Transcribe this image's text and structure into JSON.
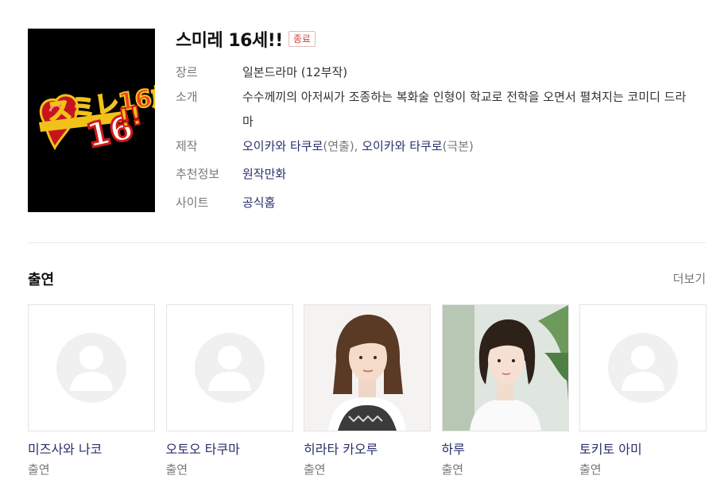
{
  "drama": {
    "title": "스미레 16세!!",
    "status_badge": "종료",
    "poster_logo": "スミレ16歳!!",
    "info": {
      "genre_label": "장르",
      "genre_value": "일본드라마 (12부작)",
      "intro_label": "소개",
      "intro_value": "수수께끼의 아저씨가 조종하는 복화술 인형이 학교로 전학을 오면서 펼쳐지는 코미디 드라마",
      "production_label": "제작",
      "production_director_name": "오이카와 타쿠로",
      "production_director_role": "(연출),",
      "production_writer_name": "오이카와 타쿠로",
      "production_writer_role": "(극본)",
      "recommend_label": "추천정보",
      "recommend_value": "원작만화",
      "site_label": "사이트",
      "site_value": "공식홈"
    }
  },
  "cast_section": {
    "title": "출연",
    "more_label": "더보기",
    "members": [
      {
        "name": "미즈사와 나코",
        "role": "출연",
        "photo": "placeholder-avatar-icon"
      },
      {
        "name": "오토오 타쿠마",
        "role": "출연",
        "photo": "placeholder-avatar-icon"
      },
      {
        "name": "히라타 카오루",
        "role": "출연",
        "photo": "portrait-photo"
      },
      {
        "name": "하루",
        "role": "출연",
        "photo": "portrait-photo"
      },
      {
        "name": "토키토 아미",
        "role": "출연",
        "photo": "placeholder-avatar-icon"
      }
    ]
  },
  "colors": {
    "link": "#2a2f6c",
    "label": "#777777",
    "badge": "#d0453e",
    "placeholder_bg": "#f0f0f0"
  }
}
